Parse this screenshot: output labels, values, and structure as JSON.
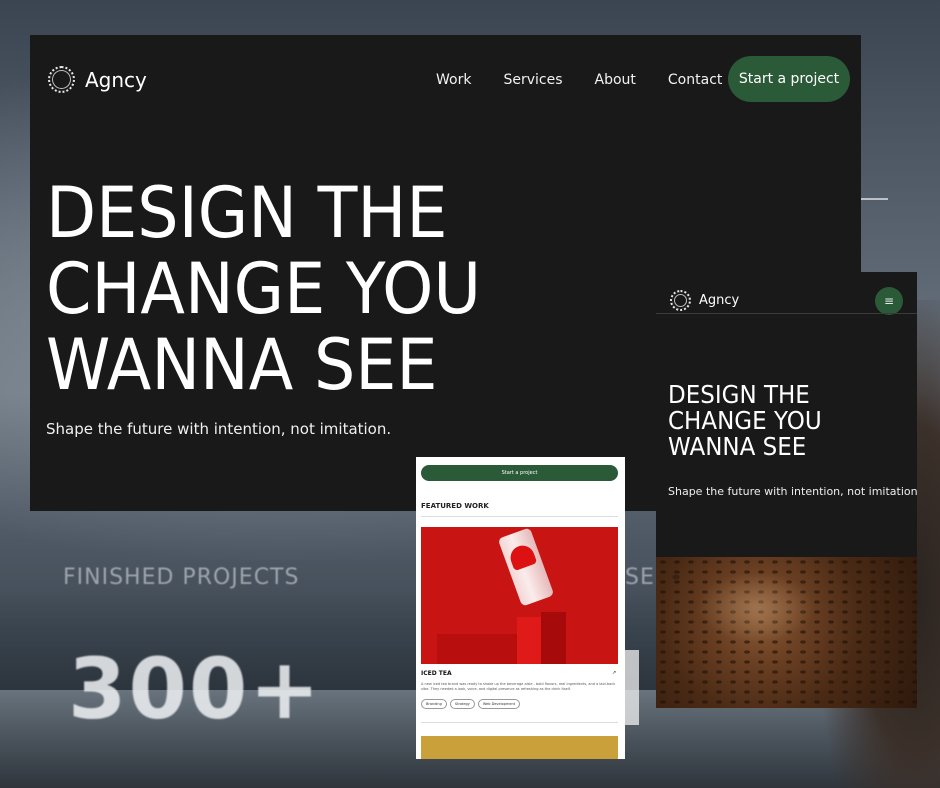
{
  "background": {
    "finished_label": "FINISHED PROJECTS",
    "finished_label_partial": "SE",
    "count": "300+"
  },
  "desktop": {
    "brand": "Agncy",
    "nav": [
      "Work",
      "Services",
      "About",
      "Contact"
    ],
    "cta": "Start a project",
    "hero_lines": [
      "DESIGN THE",
      "CHANGE YOU",
      "WANNA SEE"
    ],
    "subtitle": "Shape the future with intention, not imitation."
  },
  "mobile": {
    "brand": "Agncy",
    "menu_icon": "menu-icon",
    "hero_lines": [
      "DESIGN THE",
      "CHANGE YOU",
      "WANNA SEE"
    ],
    "subtitle": "Shape the future with intention, not imitation."
  },
  "mobile_light": {
    "cta": "Start a project",
    "section_title": "FEATURED WORK",
    "project": {
      "title": "ICED TEA",
      "arrow": "↗",
      "description": "A new iced tea brand was ready to shake up the beverage aisle - bold flavors, real ingredients, and a laid-back vibe. They needed a look, voice, and digital presence as refreshing as the drink itself.",
      "tags": [
        "Branding",
        "Strategy",
        "Web Development"
      ]
    }
  },
  "colors": {
    "accent_green": "#2a5a38",
    "dark_bg": "#191919"
  }
}
